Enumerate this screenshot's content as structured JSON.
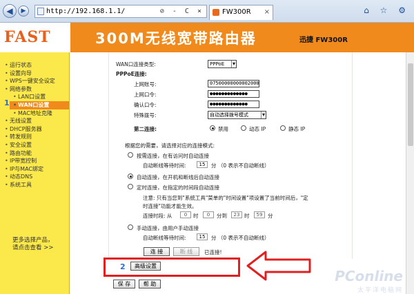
{
  "browser": {
    "url": "http://192.168.1.1/",
    "address_buttons": "⊘ - C ×",
    "tab_title": "FW300R",
    "tab_close": "×",
    "toolbar_icons": "⌂ ☆ ⚙"
  },
  "header": {
    "logo_text": "FAST",
    "title": "300M无线宽带路由器",
    "model": "迅捷 FW300R"
  },
  "sidebar": {
    "items": [
      {
        "label": "运行状态",
        "level": 0
      },
      {
        "label": "设置向导",
        "level": 0
      },
      {
        "label": "WPS一键安全设定",
        "level": 0
      },
      {
        "label": "网络参数",
        "level": 0
      },
      {
        "label": "LAN口设置",
        "level": 1
      },
      {
        "label": "WAN口设置",
        "level": 1,
        "active": true
      },
      {
        "label": "MAC地址克隆",
        "level": 1
      },
      {
        "label": "无线设置",
        "level": 0
      },
      {
        "label": "DHCP服务器",
        "level": 0
      },
      {
        "label": "转发规则",
        "level": 0
      },
      {
        "label": "安全设置",
        "level": 0
      },
      {
        "label": "路由功能",
        "level": 0
      },
      {
        "label": "IP带宽控制",
        "level": 0
      },
      {
        "label": "IP与MAC绑定",
        "level": 0
      },
      {
        "label": "动态DNS",
        "level": 0
      },
      {
        "label": "系统工具",
        "level": 0
      }
    ],
    "help_line1": "更多选择产品，",
    "help_line2": "请点击查看 >>",
    "step1": "1"
  },
  "form": {
    "wan_type_label": "WAN口连接类型:",
    "wan_type_value": "PPPoE",
    "pppoe_heading": "PPPoE连接:",
    "account_label": "上网账号:",
    "account_value": "07500000000002000",
    "password_label": "上网口令:",
    "password_value": "●●●●●●●●●●●●●",
    "confirm_label": "确认口令:",
    "confirm_value": "●●●●●●●●●●●●●",
    "dial_label": "特殊拨号:",
    "dial_value": "自动选择拨号模式",
    "second_label": "第二连接:",
    "second_opt_disable": "禁用",
    "second_opt_dynamic": "动态 IP",
    "second_opt_static": "静态 IP",
    "mode_intro": "根据您的需要，请选择对应的连接模式:",
    "mode1_label": "按需连接，在有访问时自动连接",
    "mode1_idle_label": "自动断线等待时间:",
    "mode1_idle_value": "15",
    "mode1_idle_unit": "分 （0 表示不自动断线）",
    "mode2_label": "自动连接，在开机和断线后自动连接",
    "mode3_label": "定时连接，在指定的时间段自动连接",
    "mode3_note1": "注意: 只有当您到\"系统工具\"菜单的\"时间设置\"项设置了当前时间后，\"定",
    "mode3_note2": "时连接\"功能才能生效。",
    "mode3_time_label": "连接时段: 从",
    "mode3_h1": "0",
    "mode3_u1": "时",
    "mode3_m1": "0",
    "mode3_u2": "分到",
    "mode3_h2": "23",
    "mode3_u3": "时",
    "mode3_m2": "59",
    "mode3_u4": "分",
    "mode4_label": "手动连接，由用户手动连接",
    "mode4_idle_label": "自动断线等待时间:",
    "mode4_idle_value": "15",
    "mode4_idle_unit": "分 （0 表示不自动断线）",
    "connect_btn": "连 接",
    "disconnect_btn": "断 线",
    "status_text": "已连接!",
    "step2": "2",
    "advanced_btn": "高级设置",
    "save_btn": "保 存",
    "help_btn": "帮 助"
  },
  "colors": {
    "header": "#f08a1d",
    "sidebar": "#fbe94c",
    "highlight": "#e02020",
    "step_number": "#2a6fce"
  },
  "watermark": {
    "brand": "PConline",
    "sub": "太平洋电脑网"
  }
}
